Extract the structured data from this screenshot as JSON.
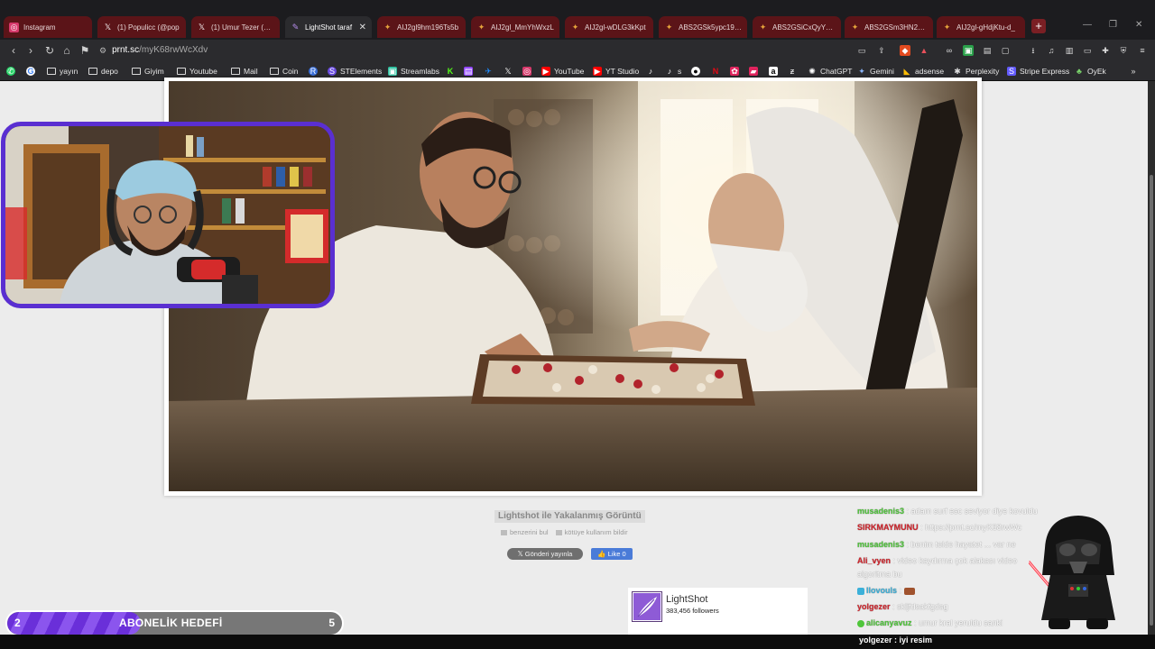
{
  "tabs": [
    {
      "title": "Instagram",
      "icon": "instagram-icon",
      "color": "#d6396b"
    },
    {
      "title": "(1) Populicc (@pop",
      "icon": "x-icon",
      "color": "#000000"
    },
    {
      "title": "(1) Umur Tezer (@U",
      "icon": "x-icon",
      "color": "#000000"
    },
    {
      "title": "LightShot taraf",
      "icon": "lightshot-icon",
      "color": "#7a4bc8"
    },
    {
      "title": "AIJ2gl9hm196Ts5b",
      "icon": "app-icon",
      "color": "#e5a33b"
    },
    {
      "title": "AIJ2gl_MmYhWxzL",
      "icon": "app-icon",
      "color": "#e5a33b"
    },
    {
      "title": "AIJ2gl-wDLG3kKpt",
      "icon": "app-icon",
      "color": "#e5a33b"
    },
    {
      "title": "ABS2GSk5ypc19uv",
      "icon": "app-icon",
      "color": "#e5a33b"
    },
    {
      "title": "ABS2GSiCxQyYJU3",
      "icon": "app-icon",
      "color": "#e5a33b"
    },
    {
      "title": "ABS2GSm3HN2pfjc",
      "icon": "app-icon",
      "color": "#e5a33b"
    },
    {
      "title": "AIJ2gl-gHdjKtu-d_",
      "icon": "app-icon",
      "color": "#e5a33b"
    }
  ],
  "address": {
    "domain": "prnt.sc",
    "path": "/myK68rwWcXdv"
  },
  "bookmarks": [
    {
      "label": "yayın",
      "type": "folder"
    },
    {
      "label": "depo",
      "type": "folder"
    },
    {
      "label": "Giyim",
      "type": "folder"
    },
    {
      "label": "Youtube",
      "type": "folder"
    },
    {
      "label": "Mail",
      "type": "folder"
    },
    {
      "label": "Coin",
      "type": "folder"
    },
    {
      "label": "STElements",
      "type": "site"
    },
    {
      "label": "Streamlabs",
      "type": "site"
    },
    {
      "label": "YouTube",
      "type": "site"
    },
    {
      "label": "YT Studio",
      "type": "site"
    },
    {
      "label": "s",
      "type": "site"
    },
    {
      "label": "ChatGPT",
      "type": "site"
    },
    {
      "label": "Gemini",
      "type": "site"
    },
    {
      "label": "adsense",
      "type": "site"
    },
    {
      "label": "Perplexity",
      "type": "site"
    },
    {
      "label": "Stripe Express",
      "type": "site"
    },
    {
      "label": "OyEk",
      "type": "site"
    }
  ],
  "page": {
    "caption": "Lightshot ile Yakalanmış Görüntü",
    "find_similar": "benzerini bul",
    "report_abuse": "kötüye kullanım bildir",
    "x_button": "Gönderi yayınla",
    "like_button": "Like 0",
    "lightshot_name": "LightShot",
    "lightshot_followers": "383,456 followers"
  },
  "goal": {
    "current": "2",
    "label": "ABONELİK HEDEFİ",
    "target": "5",
    "progress": 0.4
  },
  "chat": [
    {
      "user": "musadenis3",
      "msg": "adam surf esc seviyor diye kovuldu",
      "color": "#4fc63a"
    },
    {
      "user": "SIRKMAYMUNU",
      "msg": "https://prnt.sc/myK68rwWc",
      "color": "#d2222a"
    },
    {
      "user": "musadenis3",
      "msg": "benim telde hayatet ... var ne",
      "color": "#4fc63a"
    },
    {
      "user": "Ali_vyen",
      "msg": "video kaydırma çok alakası video",
      "color": "#d2222a"
    },
    {
      "user": "",
      "msg": "algoritma bu",
      "color": "#ffffff"
    },
    {
      "user": "llovouls",
      "msg": "",
      "color": "#3bb0d9"
    },
    {
      "user": "yolgezer",
      "msg": "skljfdsakfgdsg",
      "color": "#d2222a"
    },
    {
      "user": "alicanyavuz",
      "msg": "umur kral yeruldu sanki",
      "color": "#4fc63a"
    }
  ],
  "chat_last": {
    "user": "yolgezer",
    "msg": "iyi resim"
  }
}
